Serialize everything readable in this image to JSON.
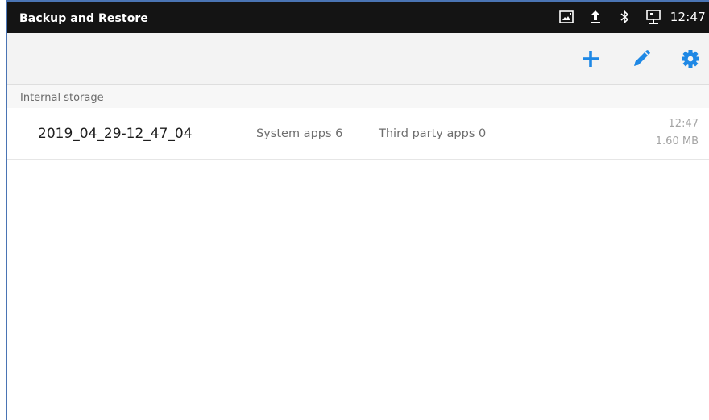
{
  "status_bar": {
    "title": "Backup and Restore",
    "time": "12:47",
    "icons": [
      "screenshot-icon",
      "upload-icon",
      "bluetooth-icon",
      "ethernet-icon"
    ]
  },
  "toolbar": {
    "accent_color": "#1e88e5",
    "buttons": [
      "add-icon",
      "edit-icon",
      "settings-icon"
    ]
  },
  "section": {
    "title": "Internal storage"
  },
  "backups": [
    {
      "name": "2019_04_29-12_47_04",
      "system_apps": "System apps  6",
      "third_party_apps": "Third party apps  0",
      "time": "12:47",
      "size": "1.60 MB"
    }
  ]
}
